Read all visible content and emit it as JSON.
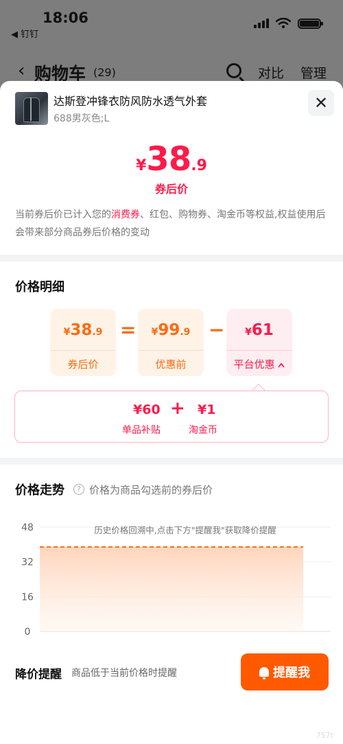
{
  "status": {
    "time": "18:06",
    "back_app": "◀ 钉钉"
  },
  "cart": {
    "title": "购物车",
    "count": "(29)",
    "compare": "对比",
    "manage": "管理"
  },
  "product": {
    "title": "达斯登冲锋衣防风防水透气外套",
    "spec": "688男灰色;L"
  },
  "price": {
    "symbol": "¥",
    "int": "38",
    "dec": ".9",
    "label": "券后价"
  },
  "notice": {
    "part1": "当前券后价已计入您的",
    "highlight": "消费券",
    "part2": "、红包、购物券、淘金币等权益,权益使用后会带来部分商品券后价格的变动"
  },
  "detail": {
    "title": "价格明细",
    "boxes": [
      {
        "sym": "¥",
        "int": "38",
        "dec": ".9",
        "label": "券后价"
      },
      {
        "sym": "¥",
        "int": "99",
        "dec": ".9",
        "label": "优惠前"
      },
      {
        "sym": "¥",
        "int": "61",
        "dec": "",
        "label": "平台优惠"
      }
    ],
    "equals": "=",
    "minus": "−",
    "expand_icon": "chevron-up-icon"
  },
  "subsidies": [
    {
      "value": "¥60",
      "label": "单品补贴"
    },
    {
      "value": "¥1",
      "label": "淘金币"
    }
  ],
  "subsidy_plus": "+",
  "trend": {
    "title": "价格走势",
    "note": "价格为商品勾选前的券后价",
    "help": "?"
  },
  "chart_data": {
    "type": "area",
    "annotation": "历史价格回溯中,点击下方\"提醒我\"获取降价提醒",
    "yticks": [
      "48",
      "32",
      "16",
      "0"
    ],
    "ylim": [
      0,
      48
    ],
    "series": [
      {
        "values": [
          38.9,
          38.9
        ]
      }
    ],
    "line_color": "#ff6a10",
    "grid": true
  },
  "remind": {
    "title": "降价提醒",
    "sub": "商品低于当前价格时提醒",
    "button": "提醒我"
  },
  "watermark": "757t",
  "colors": {
    "accent": "#ff1a4a",
    "orange": "#ff5a00"
  }
}
